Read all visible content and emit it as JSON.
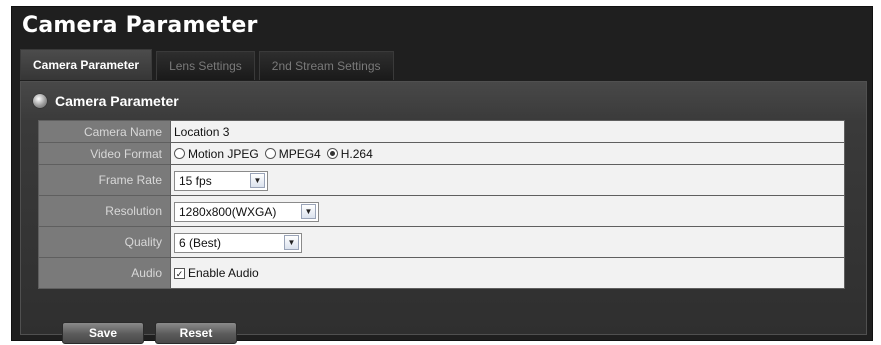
{
  "title": "Camera Parameter",
  "tabs": [
    {
      "label": "Camera Parameter",
      "active": true
    },
    {
      "label": "Lens Settings",
      "active": false
    },
    {
      "label": "2nd Stream Settings",
      "active": false
    }
  ],
  "section_title": "Camera Parameter",
  "fields": {
    "camera_name": {
      "label": "Camera Name",
      "value": "Location 3"
    },
    "video_format": {
      "label": "Video Format",
      "options": [
        {
          "label": "Motion JPEG",
          "selected": false
        },
        {
          "label": "MPEG4",
          "selected": false
        },
        {
          "label": "H.264",
          "selected": true
        }
      ]
    },
    "frame_rate": {
      "label": "Frame Rate",
      "value": "15 fps"
    },
    "resolution": {
      "label": "Resolution",
      "value": "1280x800(WXGA)"
    },
    "quality": {
      "label": "Quality",
      "value": "6 (Best)"
    },
    "audio": {
      "label": "Audio",
      "checkbox_label": "Enable Audio",
      "checked": true
    }
  },
  "buttons": {
    "save": "Save",
    "reset": "Reset"
  },
  "icons": {
    "section_bullet": "round-bullet-icon",
    "dropdown": "chevron-down-icon",
    "check": "checkmark-icon"
  },
  "colors": {
    "background": "#1f1f1f",
    "label_cell": "#7a7a7a",
    "value_cell": "#f2f2f2"
  }
}
